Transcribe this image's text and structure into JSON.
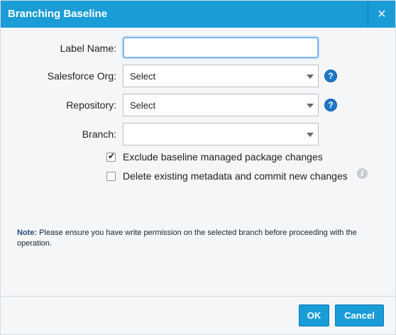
{
  "dialog": {
    "title": "Branching Baseline",
    "close_label": "×"
  },
  "form": {
    "label_name": {
      "label": "Label Name:",
      "value": ""
    },
    "salesforce_org": {
      "label": "Salesforce Org:",
      "value": "Select"
    },
    "repository": {
      "label": "Repository:",
      "value": "Select"
    },
    "branch": {
      "label": "Branch:",
      "value": ""
    },
    "help_glyph": "?",
    "info_glyph": "i"
  },
  "options": {
    "exclude_managed": {
      "label": "Exclude baseline managed package changes",
      "checked": true,
      "tick": "✔"
    },
    "delete_existing": {
      "label": "Delete existing metadata and commit new changes",
      "checked": false
    }
  },
  "note": {
    "prefix": "Note:",
    "text": " Please ensure you have write permission on the selected branch before proceeding with the operation."
  },
  "buttons": {
    "ok": "OK",
    "cancel": "Cancel"
  },
  "colors": {
    "header": "#1a9cd7",
    "primary_button": "#1a9cd7",
    "help_icon": "#1f78c8",
    "background": "#f4f6f8"
  }
}
